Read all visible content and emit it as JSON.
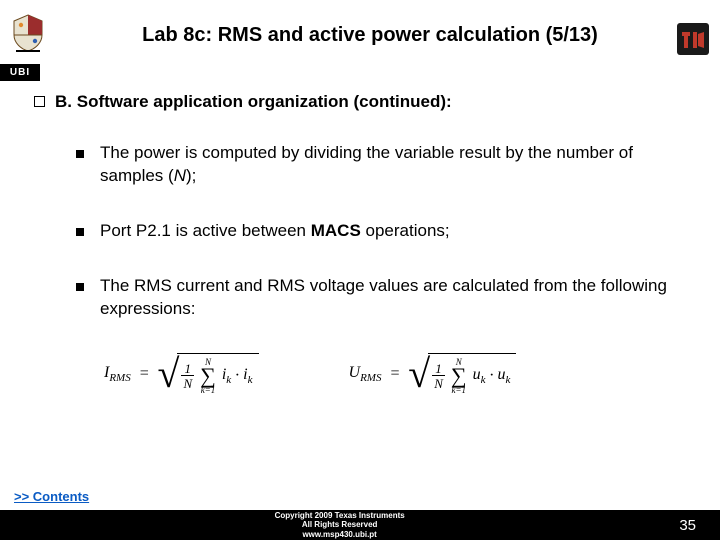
{
  "header": {
    "title": "Lab 8c: RMS and active power calculation (5/13)",
    "ubi_label": "UBI"
  },
  "section": {
    "label": "B.",
    "heading": "Software application organization (continued):"
  },
  "bullets": [
    {
      "html": "The power is computed by dividing the variable result by the number of samples (<span class=\"italic\">N</span>);"
    },
    {
      "html": "Port P2.1 is active between <span class=\"bold\">MACS</span> operations;"
    },
    {
      "html": "The RMS current and RMS voltage values are calculated from the following expressions:"
    }
  ],
  "formulas": {
    "irms": {
      "lhs": "I",
      "lhs_sub": "RMS",
      "frac_num": "1",
      "frac_den": "N",
      "sigma_top": "N",
      "sigma_bot": "k=1",
      "term1": "i",
      "term1_sub": "k",
      "term2": "i",
      "term2_sub": "k"
    },
    "urms": {
      "lhs": "U",
      "lhs_sub": "RMS",
      "frac_num": "1",
      "frac_den": "N",
      "sigma_top": "N",
      "sigma_bot": "k=1",
      "term1": "u",
      "term1_sub": "k",
      "term2": "u",
      "term2_sub": "k"
    }
  },
  "footer": {
    "contents_link": ">> Contents",
    "copyright_line1": "Copyright 2009 Texas Instruments",
    "copyright_line2": "All Rights Reserved",
    "url": "www.msp430.ubi.pt",
    "page_number": "35"
  }
}
